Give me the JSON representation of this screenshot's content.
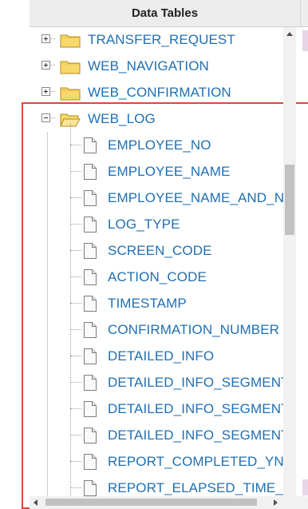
{
  "header": {
    "title": "Data Tables"
  },
  "tree": {
    "collapsed_tables": [
      "TRANSFER_REQUEST",
      "WEB_NAVIGATION",
      "WEB_CONFIRMATION"
    ],
    "expanded_table": {
      "name": "WEB_LOG",
      "columns": [
        "EMPLOYEE_NO",
        "EMPLOYEE_NAME",
        "EMPLOYEE_NAME_AND_NC",
        "LOG_TYPE",
        "SCREEN_CODE",
        "ACTION_CODE",
        "TIMESTAMP",
        "CONFIRMATION_NUMBER",
        "DETAILED_INFO",
        "DETAILED_INFO_SEGMENT",
        "DETAILED_INFO_SEGMENT",
        "DETAILED_INFO_SEGMENT",
        "REPORT_COMPLETED_YN",
        "REPORT_ELAPSED_TIME_M"
      ]
    }
  },
  "colors": {
    "link": "#1f6fb3",
    "highlight_border": "#e0453a",
    "header_bg": "#ececec"
  },
  "icons": {
    "collapsed_folder": "folder-icon",
    "open_folder": "folder-open-icon",
    "column": "document-icon",
    "expand": "plus-box-icon",
    "collapse": "minus-box-icon"
  }
}
